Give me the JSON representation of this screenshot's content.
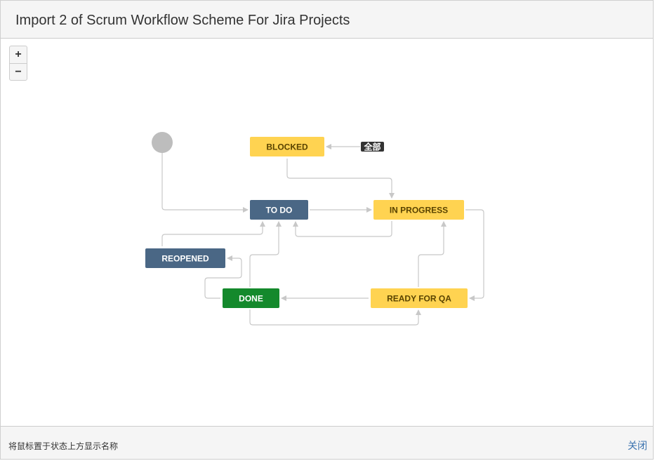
{
  "dialog": {
    "title": "Import 2 of Scrum Workflow Scheme For Jira Projects"
  },
  "zoom": {
    "in_label": "+",
    "out_label": "−"
  },
  "workflow": {
    "all_label": "全部",
    "statuses": [
      {
        "id": "blocked",
        "label": "BLOCKED",
        "category": "in-progress"
      },
      {
        "id": "todo",
        "label": "TO DO",
        "category": "todo"
      },
      {
        "id": "in-progress",
        "label": "IN PROGRESS",
        "category": "in-progress"
      },
      {
        "id": "reopened",
        "label": "REOPENED",
        "category": "todo"
      },
      {
        "id": "done",
        "label": "DONE",
        "category": "done"
      },
      {
        "id": "ready-for-qa",
        "label": "READY FOR QA",
        "category": "in-progress"
      }
    ],
    "colors": {
      "todo_bg": "#4a6785",
      "todo_text": "#ffffff",
      "in_progress_bg": "#ffd351",
      "in_progress_text": "#594300",
      "done_bg": "#14892c",
      "done_text": "#ffffff",
      "connector": "#c8c8c8",
      "start_node": "#bdbdbd",
      "all_badge_bg": "#333333"
    }
  },
  "footer": {
    "hint": "将鼠标置于状态上方显示名称",
    "close_label": "关闭"
  }
}
